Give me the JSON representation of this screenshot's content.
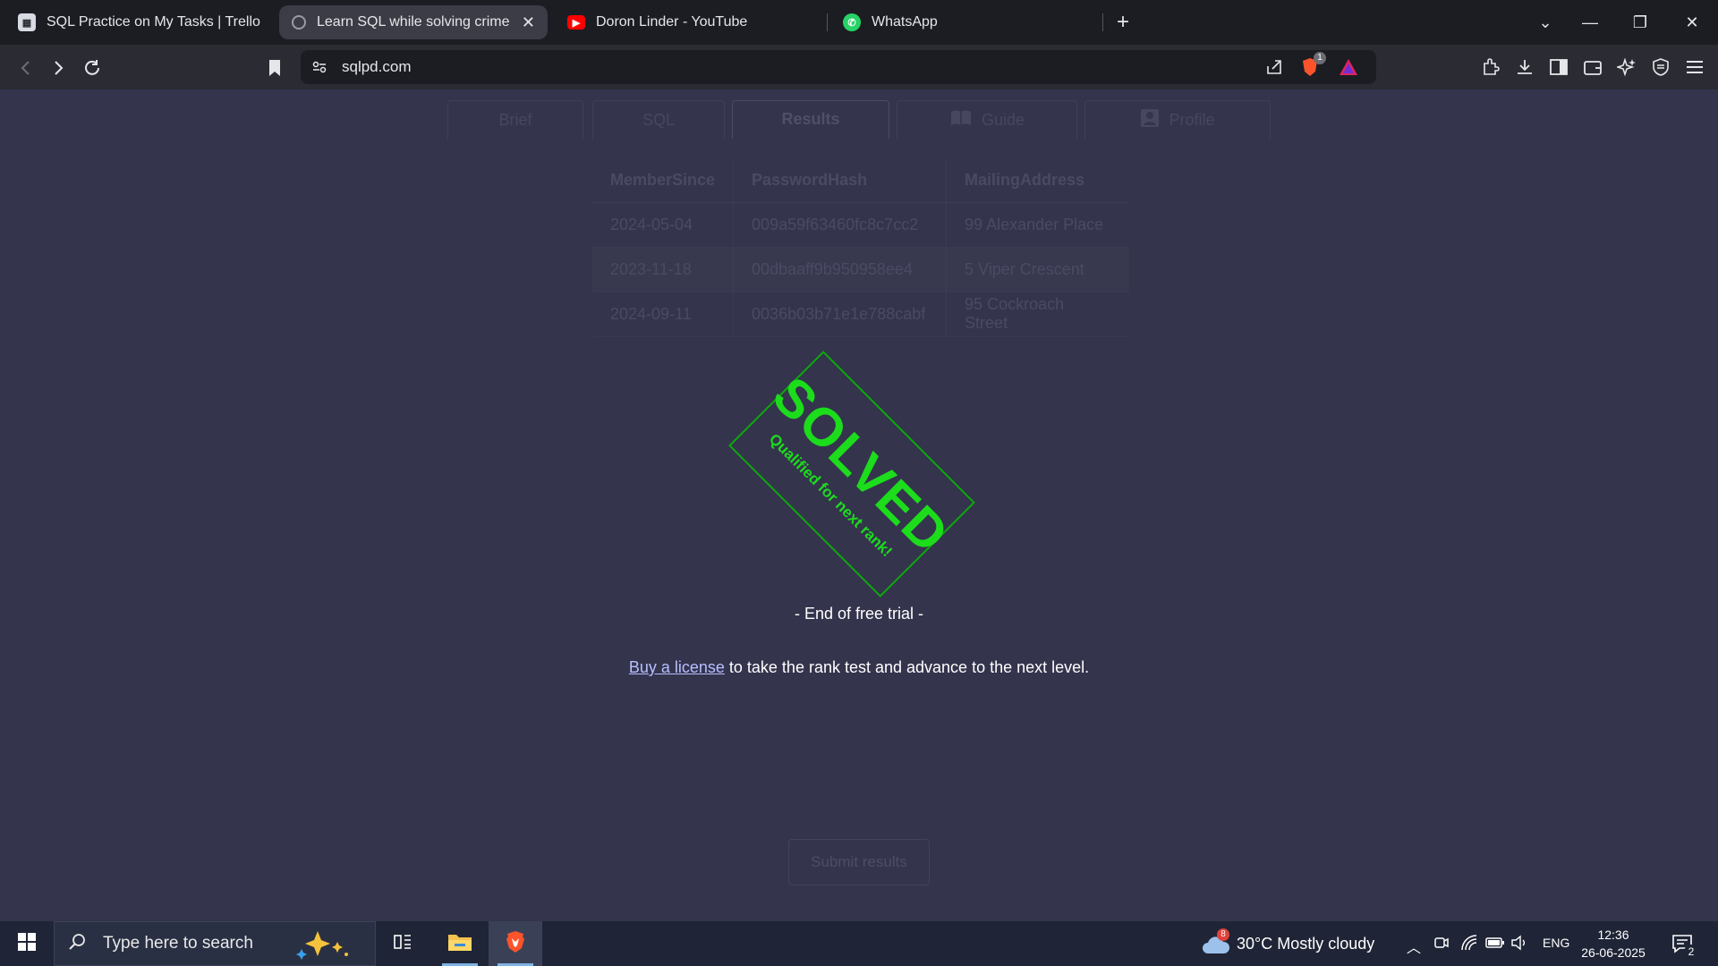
{
  "browser": {
    "tabs": [
      {
        "label": "SQL Practice on My Tasks | Trello",
        "icon": "trello-icon"
      },
      {
        "label": "Learn SQL while solving crimes! S",
        "icon": "sqlpd-icon",
        "active": true
      },
      {
        "label": "Doron Linder - YouTube",
        "icon": "youtube-icon"
      },
      {
        "label": "WhatsApp",
        "icon": "whatsapp-icon"
      }
    ],
    "url": "sqlpd.com",
    "shield_badge": "1"
  },
  "page": {
    "tabs": [
      {
        "label": "Brief"
      },
      {
        "label": "SQL"
      },
      {
        "label": "Results",
        "active": true
      },
      {
        "label": "Guide"
      },
      {
        "label": "Profile"
      }
    ],
    "results_table": {
      "columns": [
        "MemberSince",
        "PasswordHash",
        "MailingAddress"
      ],
      "rows": [
        [
          "2024-05-04",
          "009a59f63460fc8c7cc2",
          "99 Alexander Place"
        ],
        [
          "2023-11-18",
          "00dbaaff9b950958ee4",
          "5 Viper Crescent"
        ],
        [
          "2024-09-11",
          "0036b03b71e1e788cabf",
          "95 Cockroach Street"
        ]
      ]
    },
    "stamp": {
      "main": "SOLVED",
      "sub": "Qualified for next rank!",
      "color": "#1cdc1c"
    },
    "trial_notice": "- End of free trial -",
    "license": {
      "link_text": "Buy a license",
      "rest_text": " to take the rank test and advance to the next level."
    },
    "submit_label": "Submit results"
  },
  "taskbar": {
    "search_placeholder": "Type here to search",
    "weather": "30°C  Mostly cloudy",
    "weather_badge": "8",
    "language": "ENG",
    "time": "12:36",
    "date": "26-06-2025",
    "notification_count": "2"
  }
}
